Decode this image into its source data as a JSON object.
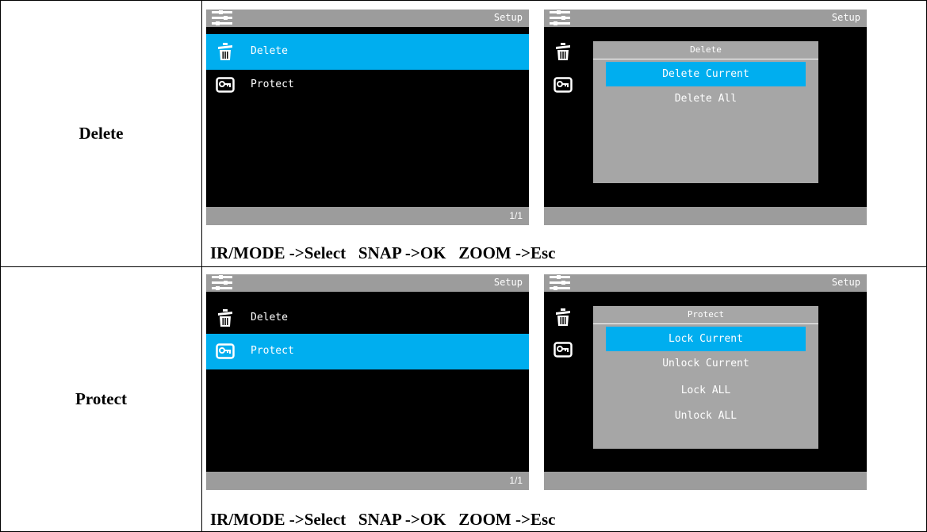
{
  "rows": [
    {
      "label": "Delete",
      "left_screen": {
        "header_title": "Setup",
        "items": [
          {
            "label": "Delete",
            "icon": "trash-icon",
            "selected": true
          },
          {
            "label": "Protect",
            "icon": "key-icon",
            "selected": false
          }
        ],
        "footer": "1/1"
      },
      "right_screen": {
        "header_title": "Setup",
        "dialog": {
          "title": "Delete",
          "options": [
            "Delete Current",
            "Delete All"
          ],
          "selected_index": 0
        }
      },
      "caption": "IR/MODE ->Select   SNAP ->OK   ZOOM ->Esc"
    },
    {
      "label": "Protect",
      "left_screen": {
        "header_title": "Setup",
        "items": [
          {
            "label": "Delete",
            "icon": "trash-icon",
            "selected": false
          },
          {
            "label": "Protect",
            "icon": "key-icon",
            "selected": true
          }
        ],
        "footer": "1/1"
      },
      "right_screen": {
        "header_title": "Setup",
        "dialog": {
          "title": "Protect",
          "options": [
            "Lock Current",
            "Unlock Current",
            "Lock ALL",
            "Unlock ALL"
          ],
          "selected_index": 0
        }
      },
      "caption": "IR/MODE ->Select   SNAP ->OK   ZOOM ->Esc"
    }
  ],
  "colors": {
    "accent": "#00aeef",
    "bar_gray": "#9c9c9c",
    "dialog_gray": "#a6a6a6",
    "screen_bg": "#000000"
  }
}
